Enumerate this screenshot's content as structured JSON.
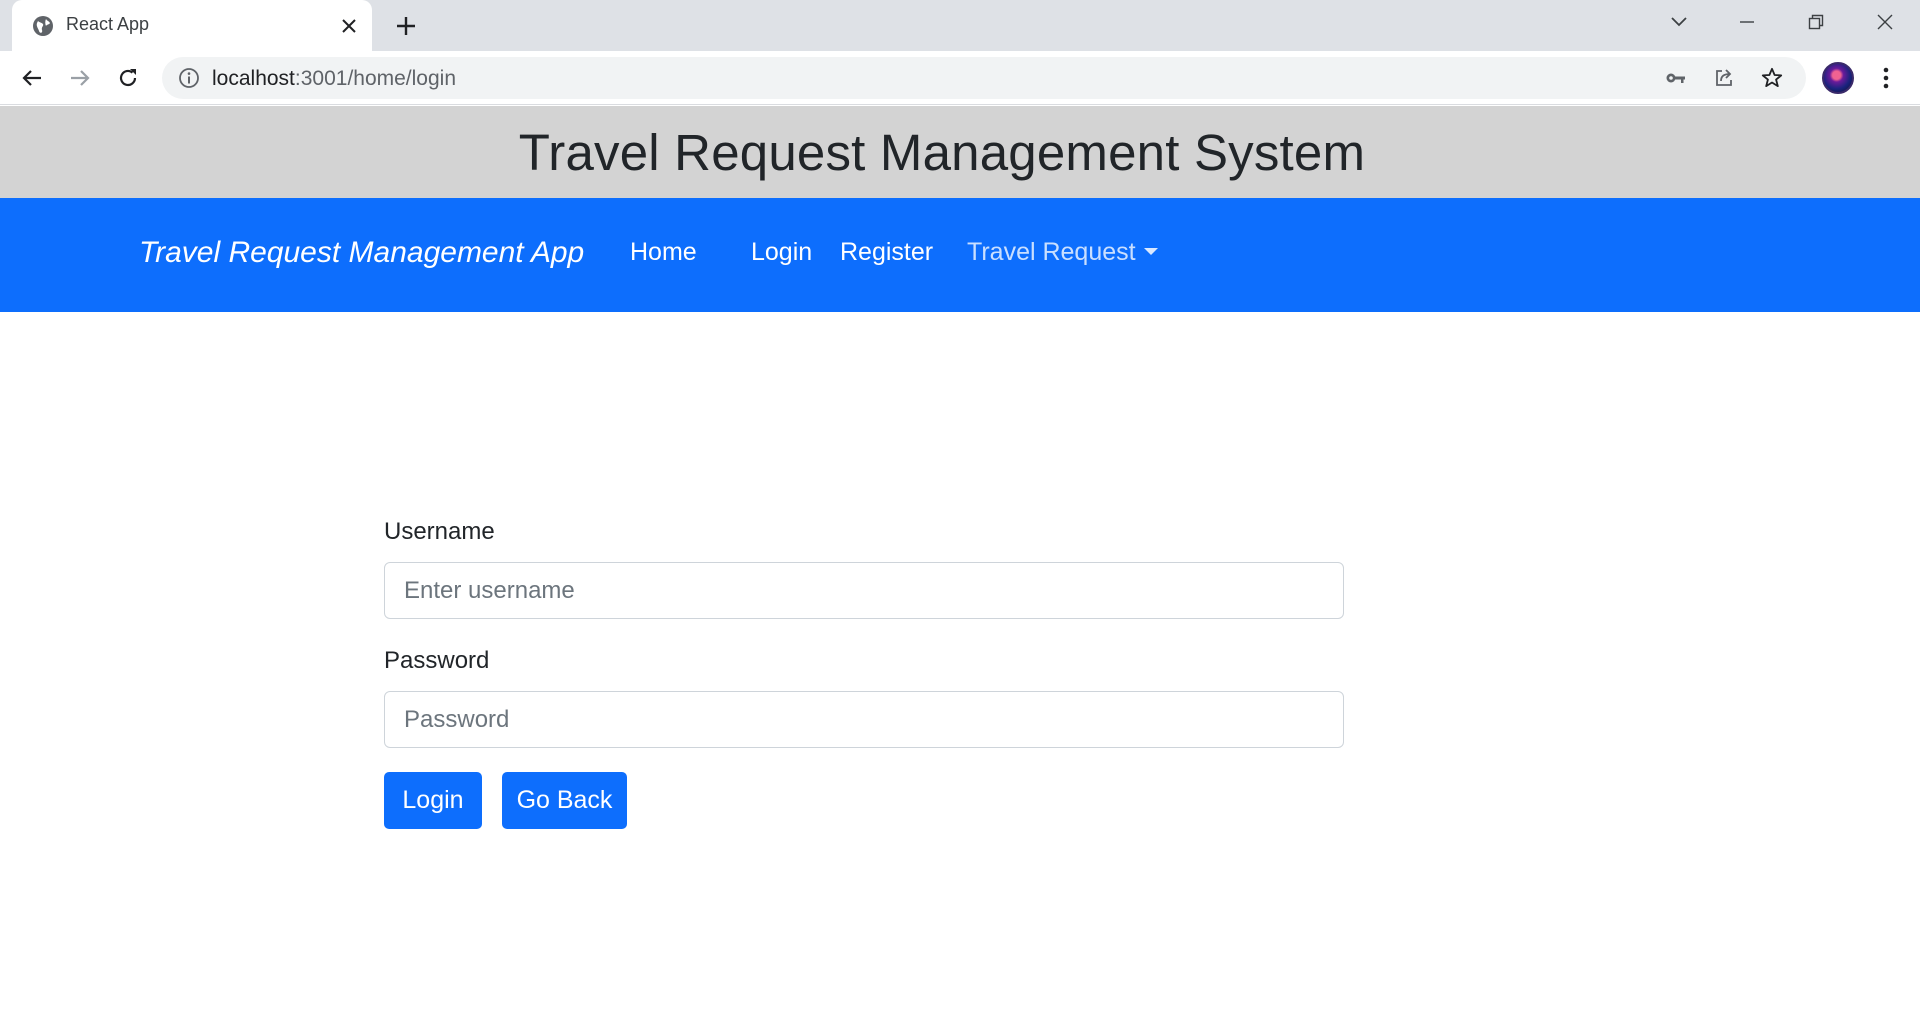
{
  "browser": {
    "tab_title": "React App",
    "url_host": "localhost",
    "url_path": ":3001/home/login",
    "icons": {
      "favicon": "globe-icon",
      "close": "close-icon",
      "new_tab": "plus-icon",
      "back": "back-arrow-icon",
      "forward": "forward-arrow-icon",
      "reload": "reload-icon",
      "site_info": "info-icon",
      "password": "key-icon",
      "share": "share-icon",
      "bookmark": "star-icon",
      "menu": "kebab-menu-icon"
    }
  },
  "header": {
    "title": "Travel Request Management System"
  },
  "navbar": {
    "brand": "Travel Request Management App",
    "links": [
      {
        "label": "Home"
      },
      {
        "label": "Login"
      },
      {
        "label": "Register"
      },
      {
        "label": "Travel Request"
      }
    ],
    "color": "#0d6efd"
  },
  "login_form": {
    "username_label": "Username",
    "username_placeholder": "Enter username",
    "username_value": "",
    "password_label": "Password",
    "password_placeholder": "Password",
    "password_value": "",
    "login_button": "Login",
    "go_back_button": "Go Back"
  },
  "colors": {
    "header_bg": "#d3d3d3",
    "primary": "#0d6efd"
  }
}
